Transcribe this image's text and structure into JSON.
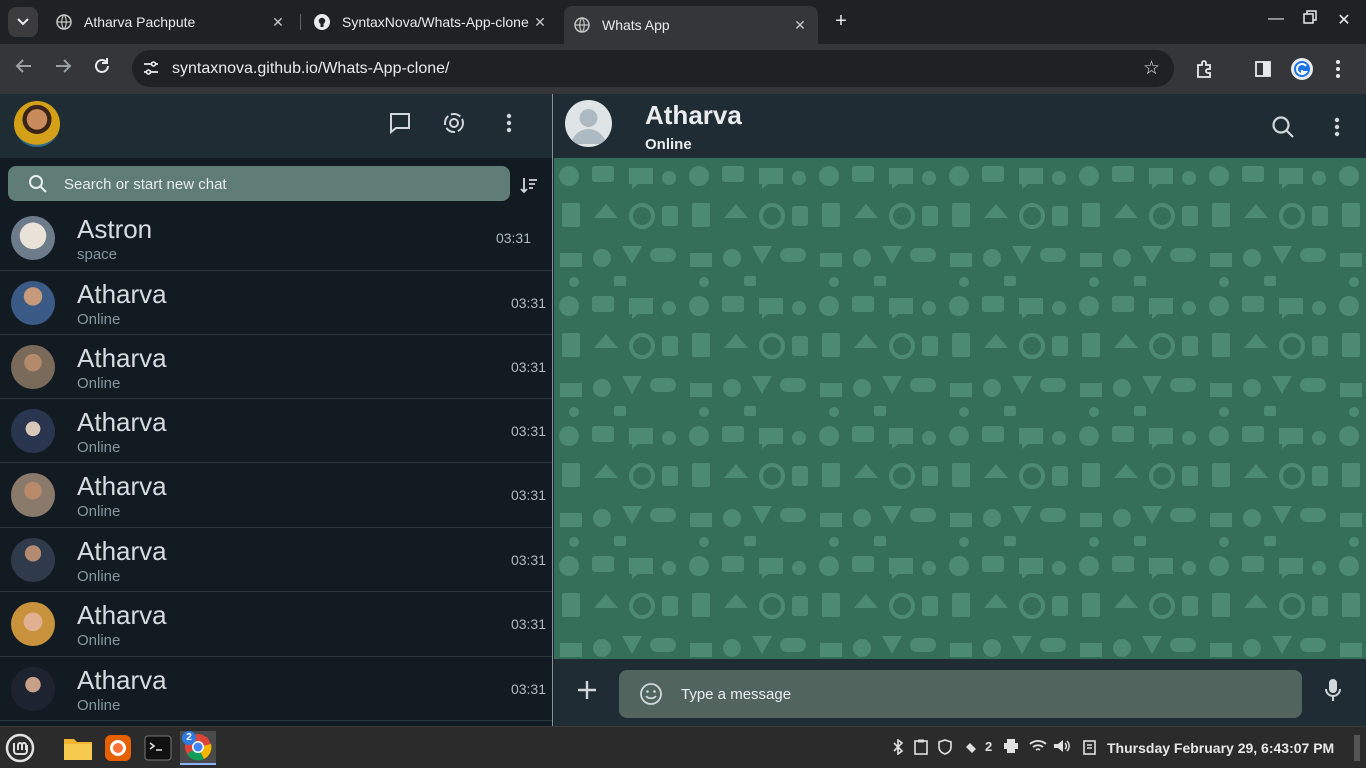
{
  "browser": {
    "tabs": [
      {
        "title": "Atharva Pachpute",
        "active": false
      },
      {
        "title": "SyntaxNova/Whats-App-clone",
        "active": false
      },
      {
        "title": "Whats App",
        "active": true
      }
    ],
    "url": "syntaxnova.github.io/Whats-App-clone/",
    "icons": {
      "back": "arrow-left-icon",
      "forward": "arrow-right-icon",
      "reload": "reload-icon",
      "bookmark": "star-icon",
      "extensions": "puzzle-icon",
      "sidepanel": "side-panel-icon",
      "profile": "profile-icon",
      "menu": "kebab-menu-icon"
    }
  },
  "sidebar": {
    "search_placeholder": "Search or start new chat",
    "chats": [
      {
        "name": "Astron",
        "sub": "space",
        "time": "03:31",
        "color": "#6d7b8a"
      },
      {
        "name": "Atharva",
        "sub": "Online",
        "time": "03:31",
        "color": "#3b5a86"
      },
      {
        "name": "Atharva",
        "sub": "Online",
        "time": "03:31",
        "color": "#7a6a5a"
      },
      {
        "name": "Atharva",
        "sub": "Online",
        "time": "03:31",
        "color": "#2a3550"
      },
      {
        "name": "Atharva",
        "sub": "Online",
        "time": "03:31",
        "color": "#8a7a6c"
      },
      {
        "name": "Atharva",
        "sub": "Online",
        "time": "03:31",
        "color": "#2f3a4a"
      },
      {
        "name": "Atharva",
        "sub": "Online",
        "time": "03:31",
        "color": "#c9933e"
      },
      {
        "name": "Atharva",
        "sub": "Online",
        "time": "03:31",
        "color": "#1d2430"
      }
    ]
  },
  "conversation": {
    "contact_name": "Atharva",
    "contact_status": "Online",
    "message_placeholder": "Type a message"
  },
  "colors": {
    "panel_header": "#202c33",
    "list_bg": "#111b21",
    "chat_wallpaper": "#356e59",
    "search_box": "#5f7d76",
    "message_box": "#52645e"
  },
  "taskbar": {
    "apps": [
      "mint-menu-icon",
      "files-icon",
      "firefox-icon",
      "terminal-icon",
      "chrome-icon"
    ],
    "chrome_badge": "2",
    "tray_count": "2",
    "clock": "Thursday February 29,  6:43:07 PM"
  }
}
